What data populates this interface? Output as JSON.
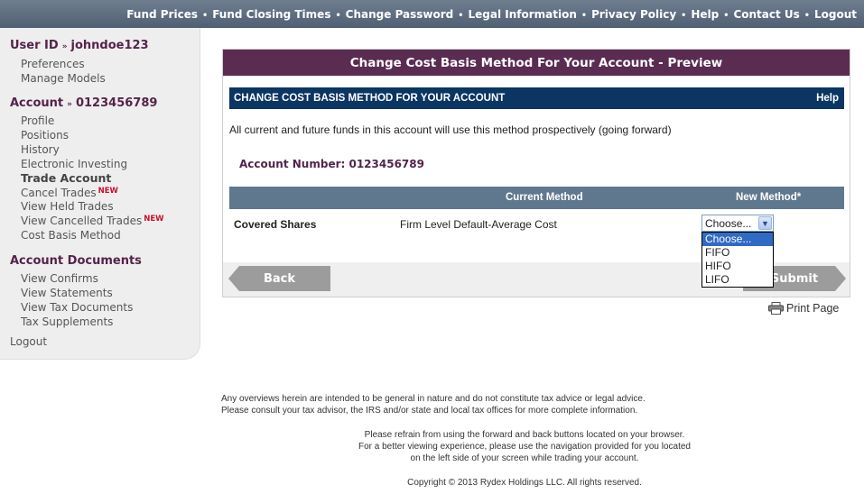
{
  "topnav": [
    "Fund Prices",
    "Fund Closing Times",
    "Change Password",
    "Legal Information",
    "Privacy Policy",
    "Help",
    "Contact Us",
    "Logout"
  ],
  "sidebar": {
    "user_label": "User ID",
    "user_id": "johndoe123",
    "user_links": [
      "Preferences",
      "Manage Models"
    ],
    "account_label": "Account",
    "account_id": "0123456789",
    "account_links": {
      "profile": "Profile",
      "positions": "Positions",
      "history": "History",
      "electronic": "Electronic Investing",
      "trade": "Trade Account",
      "cancel": "Cancel Trades",
      "held": "View Held Trades",
      "cancelled": "View Cancelled Trades",
      "cost_basis": "Cost Basis Method"
    },
    "new_badge": "NEW",
    "documents_label": "Account Documents",
    "document_links": [
      "View Confirms",
      "View Statements",
      "View Tax Documents",
      "Tax Supplements"
    ],
    "logout": "Logout"
  },
  "panel": {
    "title": "Change Cost Basis Method For Your Account - Preview",
    "section_title": "CHANGE COST BASIS METHOD FOR YOUR ACCOUNT",
    "help": "Help",
    "intro": "All current and future funds in this account will use this method prospectively (going forward)",
    "account_number_label": "Account Number:",
    "account_number": "0123456789",
    "col_current": "Current Method",
    "col_new": "New Method*",
    "row_label": "Covered Shares",
    "row_current": "Firm Level Default-Average Cost",
    "select_value": "Choose...",
    "options": [
      "Choose...",
      "FIFO",
      "HIFO",
      "LIFO"
    ],
    "back": "Back",
    "submit": "Submit"
  },
  "print_label": "Print Page",
  "disclaimer_1": "Any overviews herein are intended to be general in nature and do not constitute tax advice or legal advice.",
  "disclaimer_2": "Please consult your tax advisor, the IRS and/or state and local tax offices for more complete information.",
  "nav_note_1": "Please refrain from using the forward and back buttons located on your browser.",
  "nav_note_2": "For a better viewing experience, please use the navigation provided for you located",
  "nav_note_3": "on the left side of your screen while trading your account.",
  "copyright": "Copyright © 2013 Rydex Holdings LLC. All rights reserved."
}
